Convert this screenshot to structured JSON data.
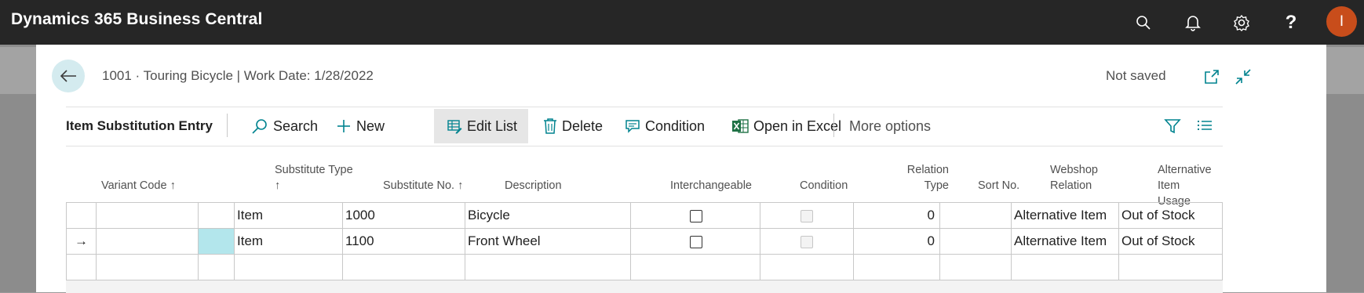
{
  "app": {
    "title": "Dynamics 365 Business Central",
    "avatar_initial": "I"
  },
  "page": {
    "title": "1001 · Touring Bicycle | Work Date: 1/28/2022",
    "status": "Not saved"
  },
  "action_bar": {
    "title": "Item Substitution Entry",
    "search_label": "Search",
    "new_label": "New",
    "edit_list_label": "Edit List",
    "delete_label": "Delete",
    "condition_label": "Condition",
    "open_excel_label": "Open in Excel",
    "more_options_label": "More options"
  },
  "columns": {
    "variant_code": "Variant Code ↑",
    "substitute_type_1": "Substitute Type",
    "substitute_type_2": "↑",
    "substitute_no": "Substitute No. ↑",
    "description": "Description",
    "interchangeable": "Interchangeable",
    "condition": "Condition",
    "relation_type_1": "Relation",
    "relation_type_2": "Type",
    "sort_no": "Sort No.",
    "webshop_relation_1": "Webshop",
    "webshop_relation_2": "Relation",
    "alt_item_usage_1": "Alternative Item",
    "alt_item_usage_2": "Usage"
  },
  "rows": [
    {
      "indicator": "",
      "variant_code": "",
      "substitute_type": "Item",
      "substitute_no": "1000",
      "description": "Bicycle",
      "interchangeable": false,
      "condition": false,
      "relation_type": "0",
      "sort_no": "",
      "webshop_relation": "Alternative Item",
      "alt_item_usage": "Out of Stock"
    },
    {
      "indicator": "→",
      "variant_code": "",
      "substitute_type": "Item",
      "substitute_no": "1100",
      "description": "Front Wheel",
      "interchangeable": false,
      "condition": false,
      "relation_type": "0",
      "sort_no": "",
      "webshop_relation": "Alternative Item",
      "alt_item_usage": "Out of Stock"
    },
    {
      "indicator": "",
      "variant_code": "",
      "substitute_type": "",
      "substitute_no": "",
      "description": "",
      "interchangeable": null,
      "condition": null,
      "relation_type": "",
      "sort_no": "",
      "webshop_relation": "",
      "alt_item_usage": ""
    }
  ],
  "colors": {
    "topbar": "#262626",
    "accent": "#00838f",
    "avatar": "#c84d1b",
    "selected_cell": "#b3e6ec",
    "excel_green": "#1e7145"
  }
}
